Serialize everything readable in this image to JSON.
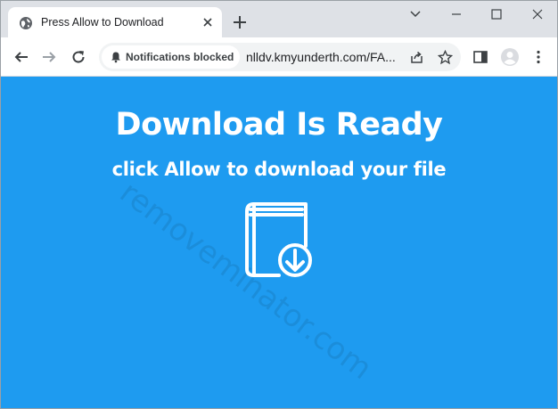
{
  "tab": {
    "title": "Press Allow to Download",
    "favicon": "globe-icon"
  },
  "window_controls": [
    "chevron-down-icon",
    "minimize-icon",
    "maximize-icon",
    "close-icon"
  ],
  "toolbar": {
    "notification_chip": "Notifications blocked",
    "url": "nlldv.kmyunderth.com/FA..."
  },
  "content": {
    "headline": "Download Is Ready",
    "subline": "click Allow to download your file",
    "watermark": "removeminator.com",
    "icon": "book-download-icon",
    "background": "#1e9bf0"
  }
}
